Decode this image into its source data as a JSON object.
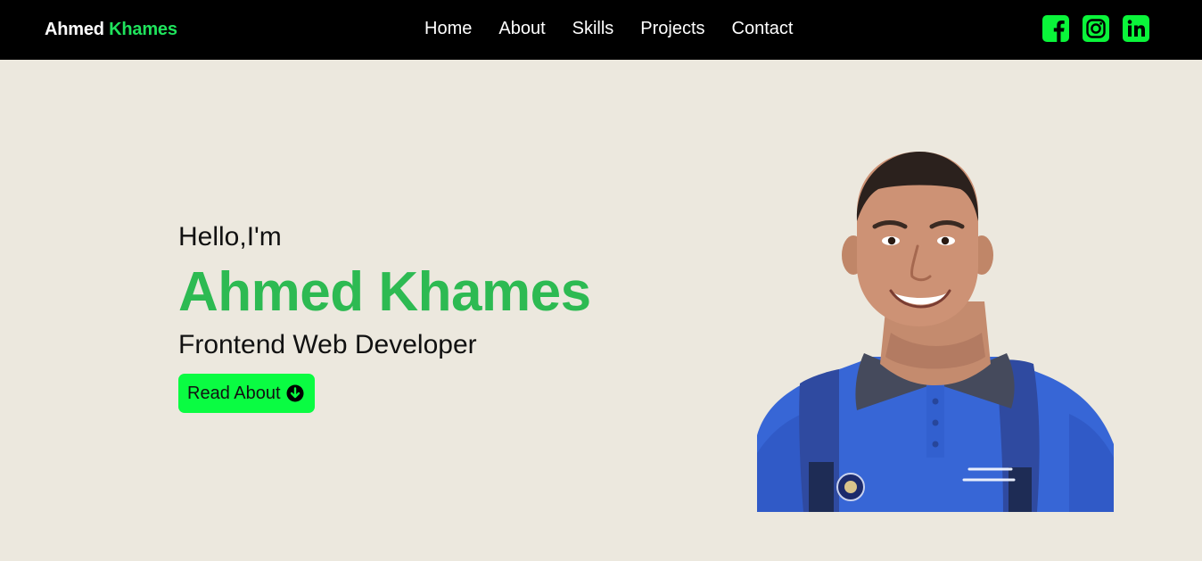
{
  "brand": {
    "first": "Ahmed",
    "last": "Khames"
  },
  "nav": {
    "items": [
      {
        "label": "Home"
      },
      {
        "label": "About"
      },
      {
        "label": "Skills"
      },
      {
        "label": "Projects"
      },
      {
        "label": "Contact"
      }
    ]
  },
  "socials": [
    {
      "icon": "facebook-icon"
    },
    {
      "icon": "instagram-icon"
    },
    {
      "icon": "linkedin-icon"
    }
  ],
  "hero": {
    "greeting": "Hello,I'm",
    "name": "Ahmed Khames",
    "role": "Frontend Web Developer",
    "button_label": "Read About",
    "button_icon": "arrow-down-circle-icon"
  },
  "colors": {
    "navbar_bg": "#000000",
    "page_bg": "#ece8de",
    "accent": "#1fe35c",
    "name_green": "#2dba52",
    "button_green": "#0afc42",
    "icon_green": "#0af53a"
  }
}
